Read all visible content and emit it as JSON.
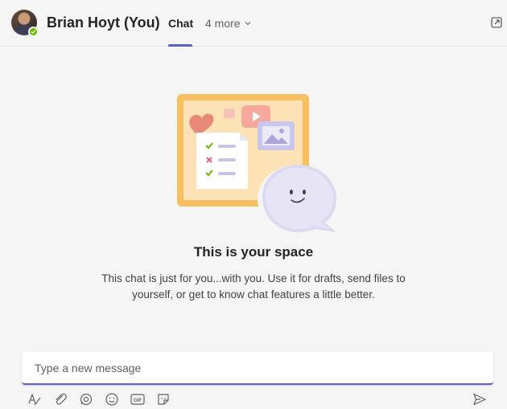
{
  "header": {
    "title": "Brian Hoyt (You)",
    "tabs": [
      {
        "label": "Chat",
        "active": true
      }
    ],
    "more_label": "4 more",
    "accent_color": "#5b5fc7",
    "presence_status": "available"
  },
  "empty_state": {
    "title": "This is your space",
    "description": "This chat is just for you...with you. Use it for drafts, send files to yourself, or get to know chat features a little better."
  },
  "compose": {
    "placeholder": "Type a new message",
    "value": ""
  },
  "toolbar": {
    "icons": [
      "format-icon",
      "attach-icon",
      "loop-icon",
      "emoji-icon",
      "gif-icon",
      "sticker-icon"
    ],
    "gif_label": "GIF",
    "send_icon": "send-icon"
  }
}
